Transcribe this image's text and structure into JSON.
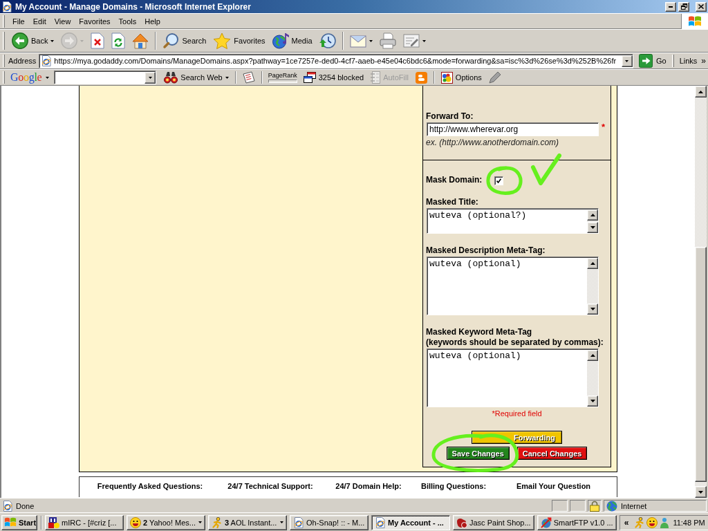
{
  "window": {
    "title": "My Account - Manage Domains - Microsoft Internet Explorer"
  },
  "menu": [
    "File",
    "Edit",
    "View",
    "Favorites",
    "Tools",
    "Help"
  ],
  "toolbar": {
    "groups": [
      [
        {
          "kind": "back",
          "label": "Back",
          "dropdown": true,
          "disabled": false
        },
        {
          "kind": "forward",
          "dropdown": true,
          "disabled": true
        },
        {
          "kind": "stop",
          "dropdown": false,
          "disabled": false
        },
        {
          "kind": "refresh",
          "dropdown": false,
          "disabled": false
        },
        {
          "kind": "home",
          "dropdown": false,
          "disabled": false
        }
      ],
      [
        {
          "kind": "search",
          "label": "Search",
          "dropdown": false,
          "disabled": false
        },
        {
          "kind": "favorites",
          "label": "Favorites",
          "dropdown": false,
          "disabled": false
        },
        {
          "kind": "media",
          "label": "Media",
          "dropdown": false,
          "disabled": false
        },
        {
          "kind": "history",
          "dropdown": false,
          "disabled": false
        }
      ],
      [
        {
          "kind": "mail",
          "dropdown": true,
          "disabled": false
        },
        {
          "kind": "print",
          "dropdown": false,
          "disabled": false
        },
        {
          "kind": "edit",
          "dropdown": true,
          "disabled": false
        }
      ]
    ]
  },
  "address_bar": {
    "label": "Address",
    "url": "https://mya.godaddy.com/Domains/ManageDomains.aspx?pathway=1ce7257e-ded0-4cf7-aaeb-e45e04c6bdc6&mode=forwarding&sa=isc%3d%26se%3d%252B%26fr",
    "go": "Go",
    "links": "Links",
    "more": "»"
  },
  "google_bar": {
    "logo": "Google",
    "groups": [
      [
        {
          "kind": "search_web",
          "label": "Search Web",
          "dropdown": true,
          "disabled": false
        }
      ],
      [
        {
          "kind": "news",
          "dropdown": false,
          "disabled": false
        }
      ],
      [
        {
          "kind": "pagerank",
          "label": "PageRank",
          "dropdown": false,
          "disabled": false
        },
        {
          "kind": "blocker",
          "label": "3254 blocked",
          "dropdown": false,
          "disabled": false
        },
        {
          "kind": "autofill",
          "label": "AutoFill",
          "dropdown": false,
          "disabled": true
        },
        {
          "kind": "blog",
          "dropdown": false,
          "disabled": false
        }
      ],
      [
        {
          "kind": "options",
          "label": "Options",
          "dropdown": false,
          "disabled": false
        },
        {
          "kind": "pencil",
          "dropdown": false,
          "disabled": false
        }
      ]
    ]
  },
  "form": {
    "forward": {
      "label": "Forward To:",
      "value": "http://www.wherevar.org",
      "required_mark": "*",
      "hint": "ex. (http://www.anotherdomain.com)"
    },
    "mask_domain": {
      "label": "Mask Domain:",
      "checked": true,
      "circled": true,
      "ticked": true
    },
    "text_fields": [
      {
        "label": "Masked Title:",
        "value": "wuteva (optional?)"
      },
      {
        "label": "Masked Description Meta-Tag:",
        "value": "wuteva (optional)"
      },
      {
        "label": "Masked Keyword Meta-Tag",
        "note": "(keywords should be separated by commas):",
        "value": "wuteva (optional)"
      }
    ],
    "required_note": "*Required field",
    "button_rows": [
      [
        {
          "label": "Forwarding",
          "color": "#f0c400",
          "circled": false
        }
      ],
      [
        {
          "label": "Save Changes",
          "color": "#23861c",
          "circled": true
        },
        {
          "label": "Cancel Changes",
          "color": "#e01010",
          "circled": false
        }
      ]
    ]
  },
  "footer": {
    "headings": [
      "Frequently Asked Questions:",
      "24/7 Technical Support:",
      "24/7 Domain Help:",
      "Billing Questions:",
      "Email Your Question"
    ]
  },
  "status_bar": {
    "text": "Done",
    "secure": true,
    "zone": "Internet"
  },
  "taskbar": {
    "start": "Start",
    "tasks": [
      {
        "kind": "mirc",
        "label": "mIRC - [#criz [...",
        "grouped": false,
        "selected": false
      },
      {
        "kind": "yahoo",
        "label": "**2** Yahoo! Mes...",
        "grouped": true,
        "selected": false
      },
      {
        "kind": "aol",
        "label": "**3** AOL Instant...",
        "grouped": true,
        "selected": false
      },
      {
        "kind": "ie",
        "label": "Oh-Snap! :: - M...",
        "grouped": false,
        "selected": false
      },
      {
        "kind": "ie",
        "label": "My Account - ...",
        "grouped": false,
        "selected": true
      },
      {
        "kind": "psp",
        "label": "Jasc Paint Shop...",
        "grouped": false,
        "selected": false
      },
      {
        "kind": "ftp",
        "label": "SmartFTP v1.0 ...",
        "grouped": false,
        "selected": false
      }
    ],
    "tray_toggle": "«",
    "tray_icons": [
      {
        "kind": "aol"
      },
      {
        "kind": "yahoo"
      },
      {
        "kind": "msn"
      }
    ],
    "clock": "11:48 PM"
  }
}
